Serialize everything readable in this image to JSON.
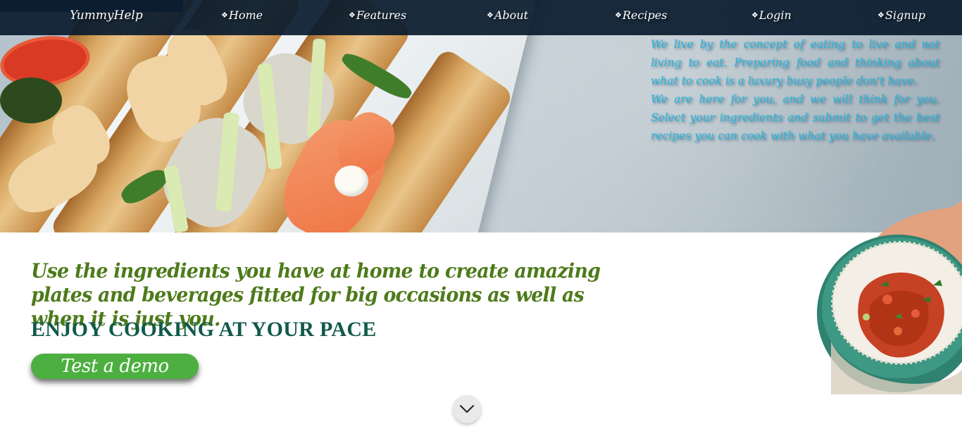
{
  "nav": {
    "brand": "YummyHelp",
    "bullet": "❖",
    "items": [
      {
        "label": "Home"
      },
      {
        "label": "Features"
      },
      {
        "label": "About"
      },
      {
        "label": "Recipes"
      },
      {
        "label": "Login"
      },
      {
        "label": "Signup"
      }
    ]
  },
  "hero": {
    "paragraphs": [
      "We live by the concept of eating to live and not living to eat. Preparing food and thinking about what to cook is a luxury busy people don't have.",
      "We are here for you, and we will think for you. Select your ingredients and submit to get the best recipes you can cook with what you have available."
    ]
  },
  "main": {
    "tagline": "Use the ingredients you have at home to create amazing plates and beverages fitted for big occasions as well as when it is just you.",
    "headline": "ENJOY COOKING AT YOUR PACE",
    "demo_button": "Test a demo"
  },
  "icons": {
    "scroll": "chevron-down-icon",
    "nav_bullet": "diamond-bullet-icon"
  },
  "colors": {
    "nav_bg": "#0a1c2e",
    "hero_text": "#22b5dd",
    "tagline": "#4d7a1a",
    "headline": "#115a4a",
    "button": "#4caf3f"
  }
}
